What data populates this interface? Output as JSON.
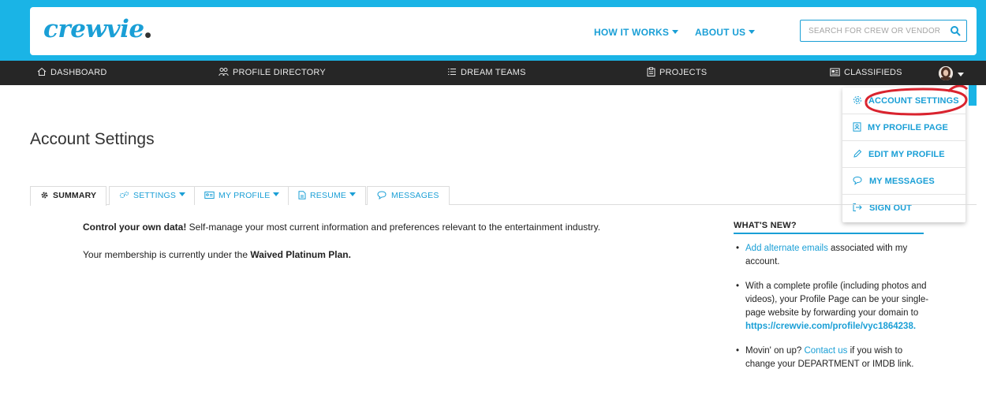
{
  "header": {
    "logo_text": "crewvie",
    "nav_links": [
      "HOW IT WORKS",
      "ABOUT US"
    ],
    "search_placeholder": "SEARCH FOR CREW OR VENDOR"
  },
  "navbar": {
    "items": [
      "DASHBOARD",
      "PROFILE DIRECTORY",
      "DREAM TEAMS",
      "PROJECTS",
      "CLASSIFIEDS"
    ]
  },
  "user_menu": {
    "items": [
      "ACCOUNT SETTINGS",
      "MY PROFILE PAGE",
      "EDIT MY PROFILE",
      "MY MESSAGES",
      "SIGN OUT"
    ]
  },
  "page": {
    "title": "Account Settings",
    "tabs": [
      "SUMMARY",
      "SETTINGS",
      "MY PROFILE",
      "RESUME",
      "MESSAGES"
    ],
    "intro_bold": "Control your own data!",
    "intro_rest": " Self-manage your most current information and preferences relevant to the entertainment industry.",
    "membership_prefix": "Your membership is currently under the ",
    "membership_plan": "Waived Platinum Plan."
  },
  "whats_new": {
    "title": "WHAT'S NEW?",
    "item1_link": "Add alternate emails",
    "item1_rest": " associated with my account.",
    "item2_text": "With a complete profile (including photos and videos), your Profile Page can be your single-page website by forwarding your domain to ",
    "item2_link": "https://crewvie.com/profile/vyc1864238.",
    "item3_prefix": "Movin' on up? ",
    "item3_link": "Contact us",
    "item3_rest": " if you wish to change your DEPARTMENT or IMDB link."
  },
  "colors": {
    "brand_blue": "#1a9fd6",
    "top_band": "#1ab4e6",
    "navbar": "#262626",
    "highlight_red": "#d9232e"
  }
}
